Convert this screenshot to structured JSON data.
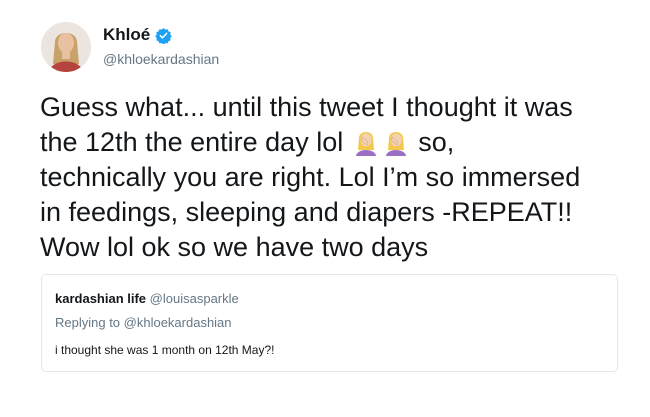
{
  "author": {
    "name": "Khloé",
    "handle": "@khloekardashian",
    "verified": true,
    "verified_color": "#1da1f2"
  },
  "tweet": {
    "line1": "Guess what... until this tweet I thought it was",
    "line2_before_emoji": "the 12th the entire day lol ",
    "emoji": "facepalm-woman-emoji",
    "line2_after_emoji": " so,",
    "line3": "technically you are right. Lol I’m so immersed",
    "line4": "in feedings, sleeping and diapers -REPEAT!!",
    "line5": "Wow lol ok so we have two days"
  },
  "quoted_tweet": {
    "name": "kardashian life",
    "handle": "@louisasparkle",
    "replying_to": "Replying to @khloekardashian",
    "text": "i thought she was 1 month on 12th May?!"
  },
  "colors": {
    "text_primary": "#14171a",
    "text_secondary": "#657786",
    "border": "#e1e8ed"
  }
}
